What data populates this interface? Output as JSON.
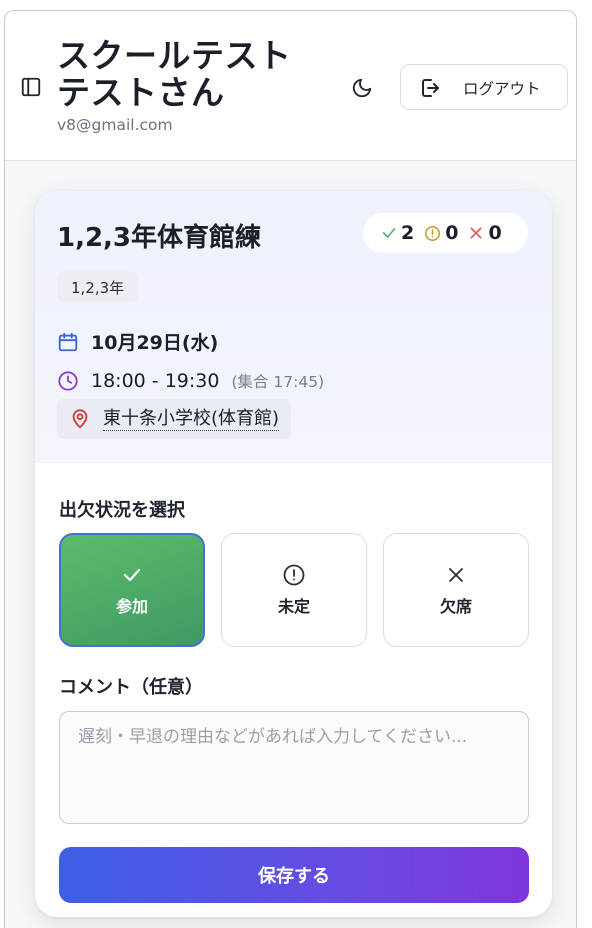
{
  "header": {
    "user_name": "スクールテスト テストさん",
    "email": "v8@gmail.com",
    "logout_label": "ログアウト",
    "icons": [
      "sidebar-toggle-icon",
      "moon-icon",
      "logout-icon"
    ]
  },
  "event": {
    "title": "1,2,3年体育館練",
    "counts": {
      "attend": "2",
      "undecided": "0",
      "absent": "0"
    },
    "grade": "1,2,3年",
    "date": "10月29日(水)",
    "time": "18:00 - 19:30",
    "gather": "(集合 17:45)",
    "location": "東十条小学校(体育館)"
  },
  "attendance": {
    "section_label": "出欠状況を選択",
    "options": [
      {
        "label": "参加",
        "icon": "check-icon",
        "selected": true
      },
      {
        "label": "未定",
        "icon": "alert-circle-icon",
        "selected": false
      },
      {
        "label": "欠席",
        "icon": "x-icon",
        "selected": false
      }
    ]
  },
  "comment": {
    "label": "コメント（任意）",
    "value": "",
    "placeholder": "遅刻・早退の理由などがあれば入力してください..."
  },
  "save_label": "保存する",
  "colors": {
    "attend_green": "#4caf6e",
    "undecided_amber": "#c9921e",
    "absent_red": "#e05252",
    "calendar_blue": "#3b63d6",
    "clock_purple": "#8a3fd1",
    "pin_red": "#d2383c",
    "save_gradient_start": "#3d5fe6",
    "save_gradient_end": "#8035dc"
  }
}
